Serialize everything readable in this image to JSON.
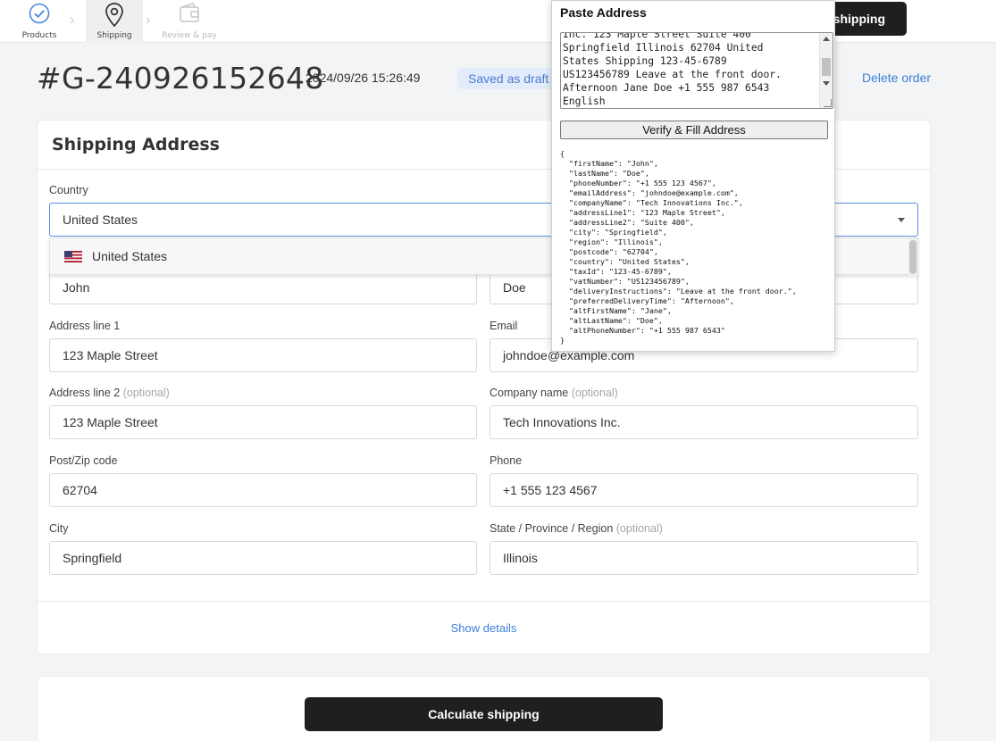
{
  "steps": [
    {
      "label": "Products"
    },
    {
      "label": "Shipping"
    },
    {
      "label": "Review & pay"
    }
  ],
  "top_button": "shipping",
  "order": {
    "id": "#G-240926152648",
    "datetime": "2024/09/26 15:26:49",
    "status": "Saved as draft",
    "delete": "Delete order"
  },
  "shipping": {
    "title": "Shipping Address",
    "country_label": "Country",
    "country_value": "United States",
    "dropdown_option": "United States",
    "first_name": "John",
    "last_name": "Doe",
    "address1_label": "Address line 1",
    "address1": "123 Maple Street",
    "email_label": "Email",
    "email": "johndoe@example.com",
    "address2_label": "Address line 2",
    "optional": "(optional)",
    "address2": "123 Maple Street",
    "company_label": "Company name",
    "company": "Tech Innovations Inc.",
    "postcode_label": "Post/Zip code",
    "postcode": "62704",
    "phone_label": "Phone",
    "phone": "+1 555 123 4567",
    "city_label": "City",
    "city": "Springfield",
    "region_label": "State / Province / Region",
    "region": "Illinois",
    "show_details": "Show details"
  },
  "calculate_button": "Calculate shipping",
  "popup": {
    "title": "Paste Address",
    "pasted_text": "Inc. 123 Maple Street Suite 400\nSpringfield Illinois 62704 United\nStates Shipping 123-45-6789\nUS123456789 Leave at the front door.\nAfternoon Jane Doe +1 555 987 6543\nEnglish",
    "verify_button": "Verify & Fill Address",
    "json_output": "{\n  \"firstName\": \"John\",\n  \"lastName\": \"Doe\",\n  \"phoneNumber\": \"+1 555 123 4567\",\n  \"emailAddress\": \"johndoe@example.com\",\n  \"companyName\": \"Tech Innovations Inc.\",\n  \"addressLine1\": \"123 Maple Street\",\n  \"addressLine2\": \"Suite 400\",\n  \"city\": \"Springfield\",\n  \"region\": \"Illinois\",\n  \"postcode\": \"62704\",\n  \"country\": \"United States\",\n  \"taxId\": \"123-45-6789\",\n  \"vatNumber\": \"US123456789\",\n  \"deliveryInstructions\": \"Leave at the front door.\",\n  \"preferredDeliveryTime\": \"Afternoon\",\n  \"altFirstName\": \"Jane\",\n  \"altLastName\": \"Doe\",\n  \"altPhoneNumber\": \"+1 555 987 6543\"\n}"
  },
  "colors": {
    "accent": "#3b7fd9",
    "button_dark": "#1f1f1f",
    "badge_bg": "#e3ecfb"
  }
}
